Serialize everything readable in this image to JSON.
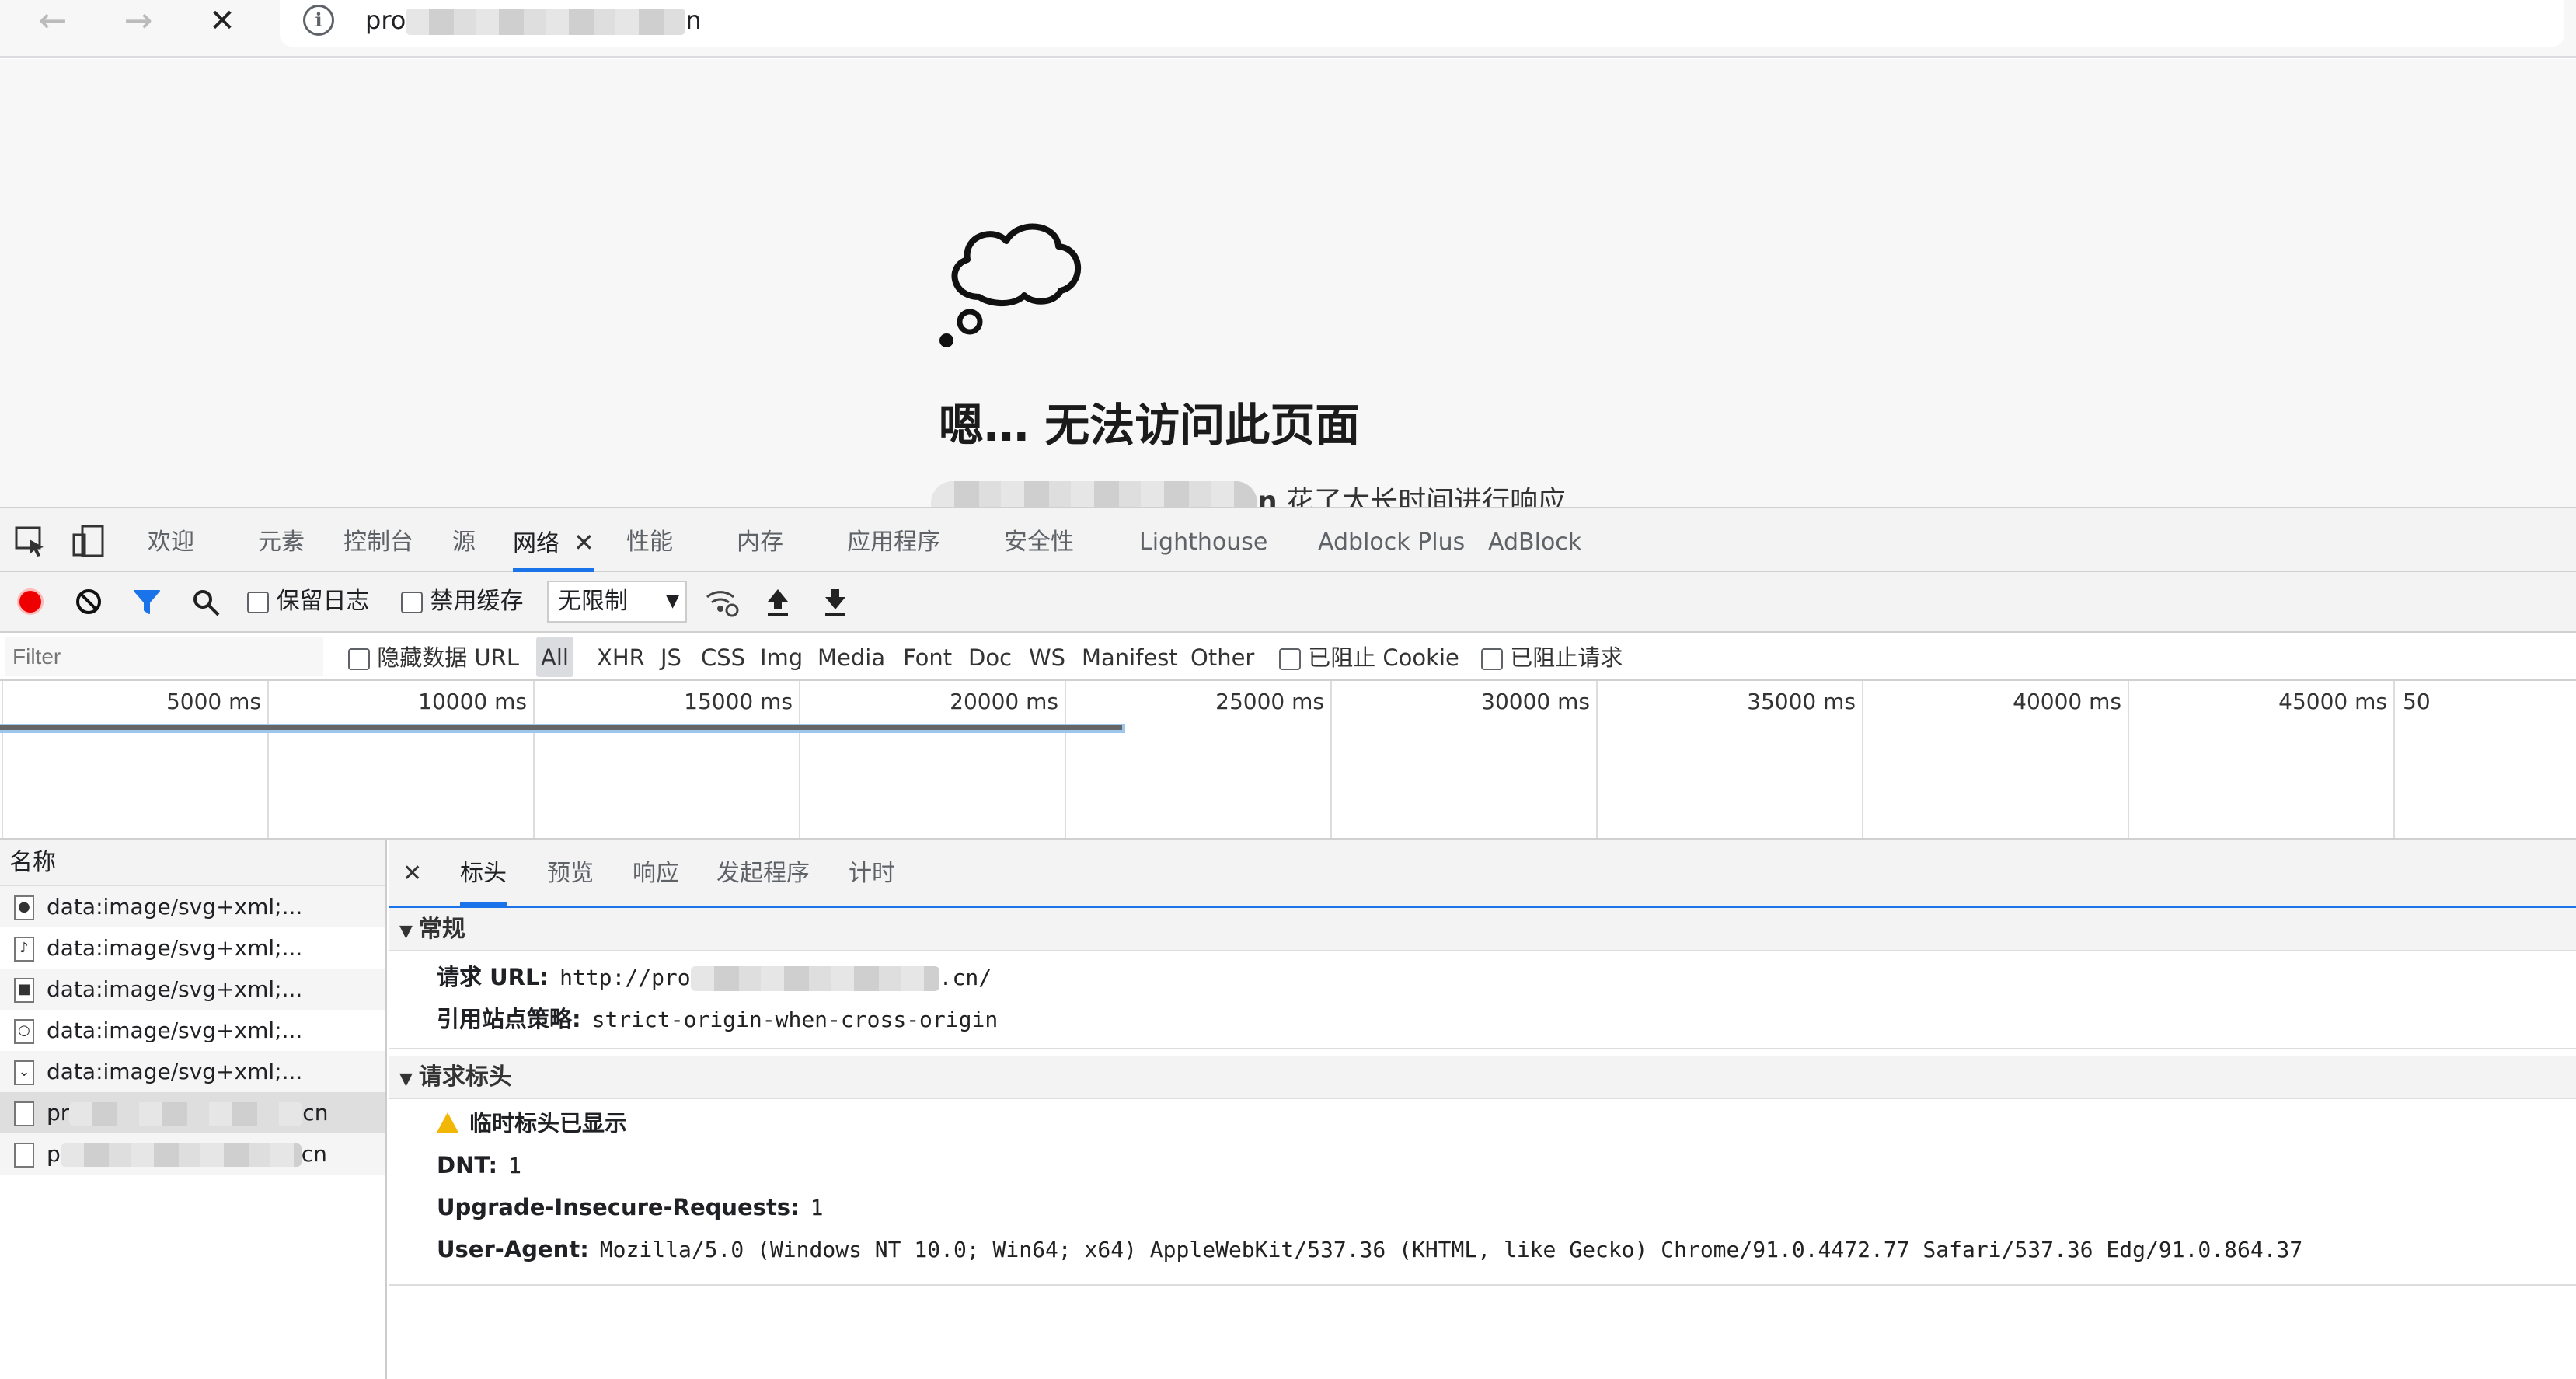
{
  "browser": {
    "back_glyph": "←",
    "forward_glyph": "→",
    "stop_glyph": "✕",
    "info_glyph": "i",
    "url_start": "pro",
    "url_end": "n"
  },
  "page": {
    "error_title": "嗯… 无法访问此页面",
    "error_sub_domain_end": "n",
    "error_sub_text": "花了太长时间进行响应"
  },
  "devtools": {
    "tabs": [
      {
        "label": "欢迎"
      },
      {
        "label": "元素"
      },
      {
        "label": "控制台"
      },
      {
        "label": "源"
      },
      {
        "label": "网络",
        "active": true
      },
      {
        "label": "性能"
      },
      {
        "label": "内存"
      },
      {
        "label": "应用程序"
      },
      {
        "label": "安全性"
      },
      {
        "label": "Lighthouse"
      },
      {
        "label": "Adblock Plus"
      },
      {
        "label": "AdBlock"
      }
    ],
    "close_glyph": "✕"
  },
  "toolbar": {
    "preserve_log_label": "保留日志",
    "disable_cache_label": "禁用缓存",
    "throttle_value": "无限制",
    "throttle_arrow": "▼"
  },
  "filter": {
    "placeholder": "Filter",
    "hide_data_urls_label": "隐藏数据 URL",
    "types": [
      "All",
      "XHR",
      "JS",
      "CSS",
      "Img",
      "Media",
      "Font",
      "Doc",
      "WS",
      "Manifest",
      "Other"
    ],
    "blocked_cookies_label": "已阻止 Cookie",
    "blocked_requests_label": "已阻止请求"
  },
  "timeline": {
    "ticks": [
      "5000 ms",
      "10000 ms",
      "15000 ms",
      "20000 ms",
      "25000 ms",
      "30000 ms",
      "35000 ms",
      "40000 ms",
      "45000 ms",
      "50"
    ]
  },
  "requests": {
    "column_header": "名称",
    "rows": [
      {
        "name": "data:image/svg+xml;...",
        "icon": "circle-icon"
      },
      {
        "name": "data:image/svg+xml;...",
        "icon": "note-icon"
      },
      {
        "name": "data:image/svg+xml;...",
        "icon": "video-icon"
      },
      {
        "name": "data:image/svg+xml;...",
        "icon": "magnifier-icon"
      },
      {
        "name": "data:image/svg+xml;...",
        "icon": "chevron-icon"
      },
      {
        "name_start": "pr",
        "name_end": "cn",
        "selected": true
      },
      {
        "name_start": "p",
        "name_end": "cn"
      }
    ]
  },
  "details": {
    "close_glyph": "✕",
    "tabs": [
      {
        "label": "标头",
        "active": true
      },
      {
        "label": "预览"
      },
      {
        "label": "响应"
      },
      {
        "label": "发起程序"
      },
      {
        "label": "计时"
      }
    ],
    "general": {
      "title": "常规",
      "request_url_key": "请求 URL:",
      "request_url_start": "http://pro",
      "request_url_end": ".cn/",
      "referrer_key": "引用站点策略:",
      "referrer_value": "strict-origin-when-cross-origin"
    },
    "request_headers": {
      "title": "请求标头",
      "warning": "临时标头已显示",
      "items": [
        {
          "key": "DNT:",
          "value": "1"
        },
        {
          "key": "Upgrade-Insecure-Requests:",
          "value": "1"
        },
        {
          "key": "User-Agent:",
          "value": "Mozilla/5.0 (Windows NT 10.0; Win64; x64) AppleWebKit/537.36 (KHTML, like Gecko) Chrome/91.0.4472.77 Safari/537.36 Edg/91.0.864.37"
        }
      ]
    }
  }
}
